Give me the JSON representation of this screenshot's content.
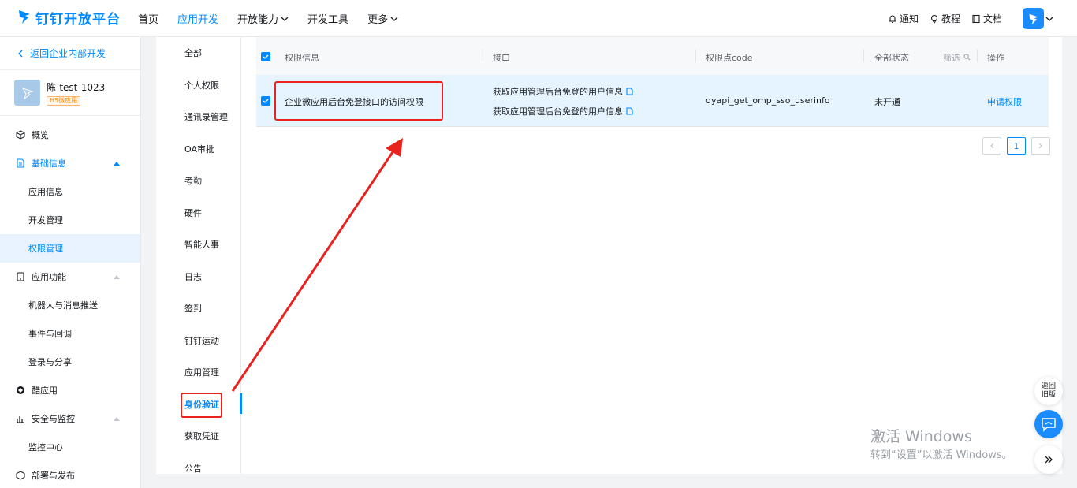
{
  "header": {
    "logo_text": "钉钉开放平台",
    "nav": [
      {
        "label": "首页"
      },
      {
        "label": "应用开发"
      },
      {
        "label": "开放能力"
      },
      {
        "label": "开发工具"
      },
      {
        "label": "更多"
      }
    ],
    "tools": {
      "notify": "通知",
      "tutorial": "教程",
      "docs": "文档"
    }
  },
  "sidebar": {
    "back_label": "返回企业内部开发",
    "app_name": "陈-test-1023",
    "app_tag": "H5微应用",
    "overview": "概览",
    "basic_info": "基础信息",
    "basic_sub": [
      "应用信息",
      "开发管理",
      "权限管理"
    ],
    "app_features": "应用功能",
    "feature_sub": [
      "机器人与消息推送",
      "事件与回调",
      "登录与分享"
    ],
    "cool_app": "酷应用",
    "security": "安全与监控",
    "security_sub": [
      "监控中心"
    ],
    "partial": "部署与发布"
  },
  "categories": [
    "全部",
    "个人权限",
    "通讯录管理",
    "OA审批",
    "考勤",
    "硬件",
    "智能人事",
    "日志",
    "签到",
    "钉钉运动",
    "应用管理",
    "身份验证",
    "获取凭证",
    "公告"
  ],
  "table": {
    "headers": {
      "perm": "权限信息",
      "api": "接口",
      "code": "权限点code",
      "status": "全部状态",
      "filter": "筛选",
      "action": "操作"
    },
    "rows": [
      {
        "perm": "企业微应用后台免登接口的访问权限",
        "apis": [
          "获取应用管理后台免登的用户信息",
          "获取应用管理后台免登的用户信息"
        ],
        "code": "qyapi_get_omp_sso_userinfo",
        "status": "未开通",
        "action": "申请权限"
      }
    ]
  },
  "pager": {
    "current": "1"
  },
  "floating": {
    "old_version": "返回旧版"
  },
  "watermark": {
    "line1": "激活 Windows",
    "line2": "转到“设置”以激活 Windows。"
  },
  "colors": {
    "accent": "#0089ff",
    "highlight": "#e8231e",
    "row_bg": "#e6f4ff"
  }
}
